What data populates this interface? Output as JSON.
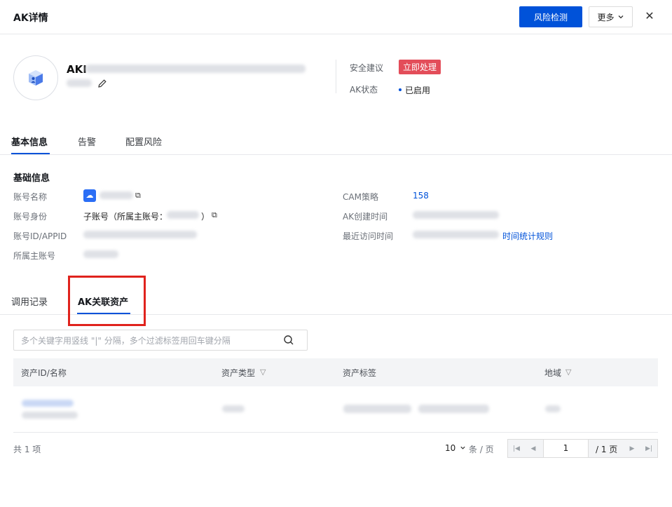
{
  "header": {
    "title": "AK详情",
    "risk_check_label": "风险检测",
    "more_label": "更多",
    "close_glyph": "✕"
  },
  "profile": {
    "ak_prefix": "AKI",
    "security_label": "安全建议",
    "security_tag": "立即处理",
    "status_label": "AK状态",
    "status_value": "已启用"
  },
  "tabs": [
    {
      "label": "基本信息",
      "active": true
    },
    {
      "label": "告警",
      "active": false
    },
    {
      "label": "配置风险",
      "active": false
    }
  ],
  "basic_info": {
    "section_title": "基础信息",
    "left": [
      {
        "key": "账号名称"
      },
      {
        "key": "账号身份",
        "value_prefix": "子账号（所属主账号：",
        "value_suffix": "）"
      },
      {
        "key": "账号ID/APPID"
      },
      {
        "key": "所属主账号"
      }
    ],
    "right": [
      {
        "key": "CAM策略",
        "value": "158"
      },
      {
        "key": "AK创建时间"
      },
      {
        "key": "最近访问时间",
        "link": "时间统计规则"
      }
    ]
  },
  "subtabs": [
    {
      "label": "调用记录",
      "active": false
    },
    {
      "label": "AK关联资产",
      "active": true
    }
  ],
  "search": {
    "placeholder": "多个关键字用竖线 \"|\" 分隔，多个过滤标签用回车键分隔"
  },
  "table": {
    "columns": [
      {
        "label": "资产ID/名称",
        "filter": false
      },
      {
        "label": "资产类型",
        "filter": true
      },
      {
        "label": "资产标签",
        "filter": false
      },
      {
        "label": "地域",
        "filter": true
      }
    ]
  },
  "pagination": {
    "total_text": "共 1 项",
    "page_size": "10",
    "page_size_unit": "条 / 页",
    "current_page": "1",
    "total_pages_text": "/ 1 页"
  },
  "colors": {
    "primary": "#0052d9",
    "danger": "#e34d59",
    "highlight_box": "#e0231d"
  },
  "icons": [
    "chevron-down-icon",
    "close-icon",
    "user-cube-icon",
    "edit-pencil-icon",
    "cloud-icon",
    "copy-icon",
    "search-icon",
    "filter-icon",
    "first-page-icon",
    "prev-page-icon",
    "next-page-icon",
    "last-page-icon"
  ]
}
